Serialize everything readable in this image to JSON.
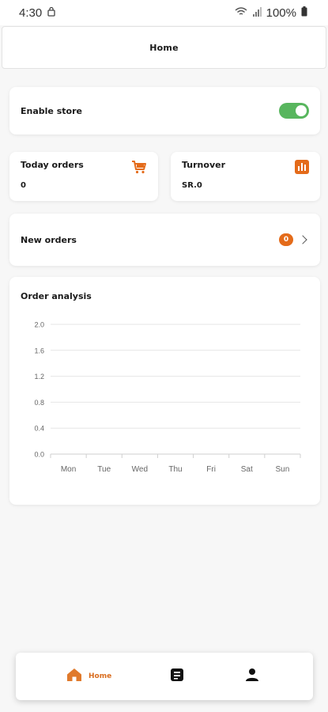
{
  "status_bar": {
    "time": "4:30",
    "battery": "100%",
    "icons": [
      "lock-icon",
      "wifi-icon",
      "signal-icon",
      "battery-icon"
    ]
  },
  "header": {
    "title": "Home"
  },
  "store": {
    "label": "Enable store",
    "enabled": true
  },
  "today_orders": {
    "label": "Today orders",
    "value": "0",
    "icon": "cart-icon"
  },
  "turnover": {
    "label": "Turnover",
    "value": "SR.0",
    "icon": "bar-chart-icon"
  },
  "new_orders": {
    "label": "New orders",
    "count": "0"
  },
  "analysis": {
    "title": "Order analysis"
  },
  "colors": {
    "accent": "#e46b1a",
    "toggle_on": "#58b65e",
    "text": "#1a1a1a",
    "grid": "#e6e6e6"
  },
  "chart_data": {
    "type": "line",
    "categories": [
      "Mon",
      "Tue",
      "Wed",
      "Thu",
      "Fri",
      "Sat",
      "Sun"
    ],
    "y_ticks": [
      "0.0",
      "0.4",
      "0.8",
      "1.2",
      "1.6",
      "2.0"
    ],
    "ylim": [
      0,
      2
    ],
    "series": [
      {
        "values": [
          0,
          0,
          0,
          0,
          0,
          0,
          0
        ]
      }
    ],
    "grid": true
  },
  "nav": {
    "home_label": "Home",
    "items": [
      "home-icon",
      "orders-icon",
      "profile-icon"
    ]
  }
}
